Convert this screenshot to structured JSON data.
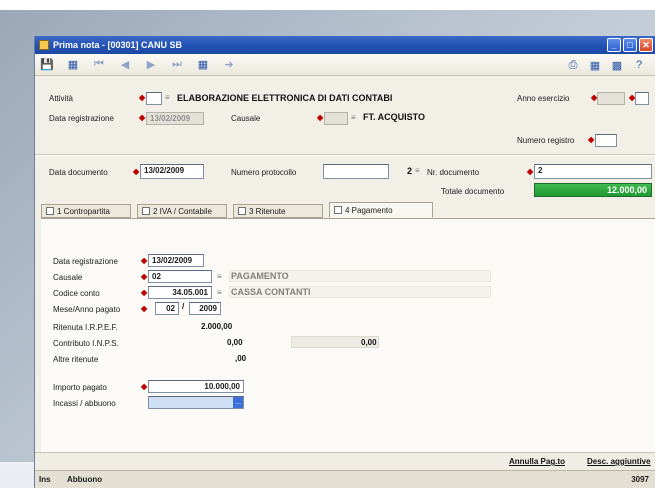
{
  "window": {
    "title": "Prima nota - [00301] CANU SB",
    "buttons": [
      "_",
      "□",
      "✕"
    ]
  },
  "toolbar": {
    "icons": [
      "save-icon",
      "refresh-icon",
      "first-icon",
      "prev-icon",
      "next-icon",
      "last-icon",
      "calendar-icon",
      "link-icon",
      "print-icon",
      "export-icon",
      "grid-icon",
      "help-icon"
    ]
  },
  "header": {
    "attivita_label": "Attività",
    "attivita_desc": "ELABORAZIONE ELETTRONICA DI DATI CONTABI",
    "anno_esercizio_label": "Anno esercizio",
    "data_registrazione_label": "Data registrazione",
    "data_registrazione_value": "13/02/2009",
    "causale_label": "Causale",
    "causale_desc": "FT. ACQUISTO",
    "numero_registro_label": "Numero registro",
    "data_documento_label": "Data documento",
    "data_documento_value": "13/02/2009",
    "numero_protocollo_label": "Numero protocollo",
    "protocollo_suffix": "2",
    "nr_documento_label": "Nr. documento",
    "nr_documento_value": "2",
    "totale_documento_label": "Totale documento",
    "totale_documento_value": "12.000,00"
  },
  "tabs": [
    {
      "label": "1 Contropartita",
      "active": false
    },
    {
      "label": "2 IVA / Contabile",
      "active": false
    },
    {
      "label": "3 Ritenute",
      "active": false
    },
    {
      "label": "4 Pagamento",
      "active": true
    }
  ],
  "pagamento": {
    "data_registrazione_label": "Data registrazione",
    "data_registrazione_value": "13/02/2009",
    "causale_label": "Causale",
    "causale_value": "02",
    "causale_desc": "PAGAMENTO",
    "codice_conto_label": "Codice conto",
    "codice_conto_value": "34.05.001",
    "codice_conto_desc": "CASSA CONTANTI",
    "mese_anno_label": "Mese/Anno pagato",
    "mese_value": "02",
    "anno_sep": "/",
    "anno_value": "2009",
    "ritenuta_label": "Ritenuta I.R.P.E.F.",
    "ritenuta_value": "2.000,00",
    "contributo_label": "Contributo I.N.P.S.",
    "contributo_value": "0,00",
    "contributo_value2": "0,00",
    "altre_label": "Altre ritenute",
    "altre_value": ",00",
    "importo_label": "Importo pagato",
    "importo_value": "10.000,00",
    "incasso_label": "Incassi / abbuono",
    "incasso_arrow": "..."
  },
  "buttonbar": {
    "annulla": "Annulla Pag.to",
    "descr": "Desc. aggiuntive"
  },
  "statusbar": {
    "left": "Ins",
    "mode": "Abbuono",
    "right": "3097"
  }
}
